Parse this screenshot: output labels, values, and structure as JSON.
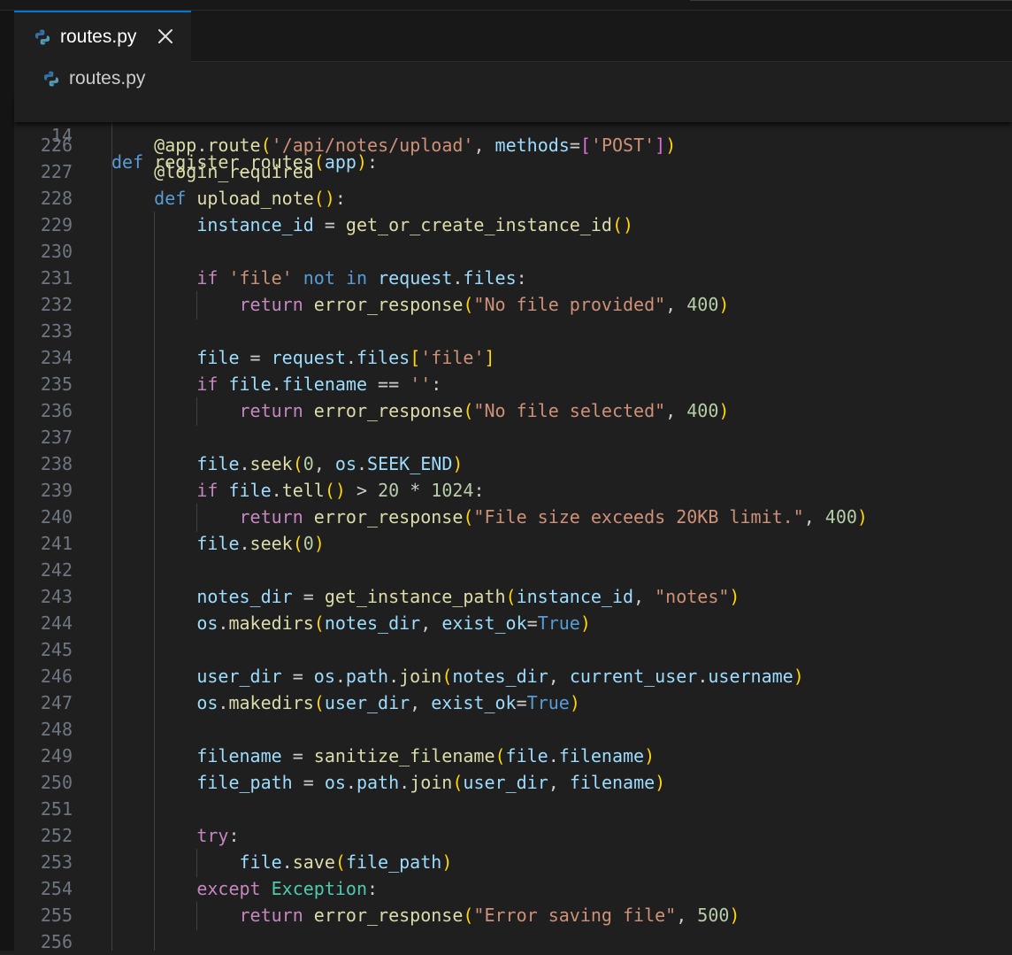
{
  "window": {
    "tab_title": "routes.py",
    "breadcrumb": "routes.py"
  },
  "icons": {
    "file_icon": "python-icon",
    "close_icon": "close-icon",
    "python_colors": [
      "#3572a5",
      "#519aba"
    ]
  },
  "sticky_scroll": {
    "line_number": "14",
    "code": "def register_routes(app):"
  },
  "editor": {
    "language": "python",
    "lines": [
      {
        "n": "226",
        "code": "    @app.route('/api/notes/upload', methods=['POST'])"
      },
      {
        "n": "227",
        "code": "    @login_required"
      },
      {
        "n": "228",
        "code": "    def upload_note():"
      },
      {
        "n": "229",
        "code": "        instance_id = get_or_create_instance_id()"
      },
      {
        "n": "230",
        "code": ""
      },
      {
        "n": "231",
        "code": "        if 'file' not in request.files:"
      },
      {
        "n": "232",
        "code": "            return error_response(\"No file provided\", 400)"
      },
      {
        "n": "233",
        "code": ""
      },
      {
        "n": "234",
        "code": "        file = request.files['file']"
      },
      {
        "n": "235",
        "code": "        if file.filename == '':"
      },
      {
        "n": "236",
        "code": "            return error_response(\"No file selected\", 400)"
      },
      {
        "n": "237",
        "code": ""
      },
      {
        "n": "238",
        "code": "        file.seek(0, os.SEEK_END)"
      },
      {
        "n": "239",
        "code": "        if file.tell() > 20 * 1024:"
      },
      {
        "n": "240",
        "code": "            return error_response(\"File size exceeds 20KB limit.\", 400)"
      },
      {
        "n": "241",
        "code": "        file.seek(0)"
      },
      {
        "n": "242",
        "code": ""
      },
      {
        "n": "243",
        "code": "        notes_dir = get_instance_path(instance_id, \"notes\")"
      },
      {
        "n": "244",
        "code": "        os.makedirs(notes_dir, exist_ok=True)"
      },
      {
        "n": "245",
        "code": ""
      },
      {
        "n": "246",
        "code": "        user_dir = os.path.join(notes_dir, current_user.username)"
      },
      {
        "n": "247",
        "code": "        os.makedirs(user_dir, exist_ok=True)"
      },
      {
        "n": "248",
        "code": ""
      },
      {
        "n": "249",
        "code": "        filename = sanitize_filename(file.filename)"
      },
      {
        "n": "250",
        "code": "        file_path = os.path.join(user_dir, filename)"
      },
      {
        "n": "251",
        "code": ""
      },
      {
        "n": "252",
        "code": "        try:"
      },
      {
        "n": "253",
        "code": "            file.save(file_path)"
      },
      {
        "n": "254",
        "code": "        except Exception:"
      },
      {
        "n": "255",
        "code": "            return error_response(\"Error saving file\", 500)"
      },
      {
        "n": "256",
        "code": ""
      }
    ]
  },
  "colors": {
    "editor_background": "#1f1f1f",
    "tab_bar_background": "#181818",
    "active_tab_border": "#0078d4",
    "line_number": "#6e7681",
    "keyword": "#569cd6",
    "control_keyword": "#c586c0",
    "function": "#dcdcaa",
    "variable": "#9cdcfe",
    "string": "#ce9178",
    "number": "#b5cea8",
    "class": "#4ec9b0",
    "bracket_1": "#ffd700",
    "bracket_2": "#da70d6"
  }
}
